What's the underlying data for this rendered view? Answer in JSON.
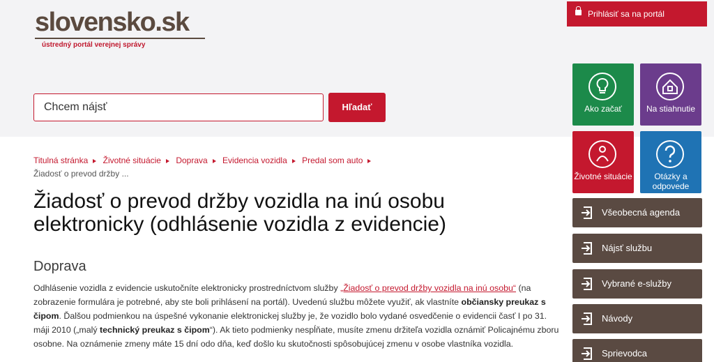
{
  "logo": {
    "name": "slovensko.sk",
    "tagline": "ústredný portál verejnej správy"
  },
  "header": {
    "login_label": "Prihlásiť sa na portál"
  },
  "search": {
    "placeholder": "Chcem nájsť",
    "button_label": "Hľadať"
  },
  "tiles": [
    {
      "label": "Ako začať",
      "icon": "lightbulb-icon",
      "color": "#1c8a4a"
    },
    {
      "label": "Na stiahnutie",
      "icon": "download-house-icon",
      "color": "#6b3c8c"
    },
    {
      "label": "Životné situácie",
      "icon": "person-icon",
      "color": "#c4182e"
    },
    {
      "label": "Otázky a odpovede",
      "icon": "question-icon",
      "color": "#1f73b4"
    }
  ],
  "side_menu": [
    {
      "label": "Všeobecná agenda"
    },
    {
      "label": "Nájsť službu"
    },
    {
      "label": "Vybrané e-služby"
    },
    {
      "label": "Návody"
    },
    {
      "label": "Sprievodca"
    }
  ],
  "breadcrumb": {
    "items": [
      "Titulná stránka",
      "Životné situácie",
      "Doprava",
      "Evidencia vozidla",
      "Predal som auto"
    ],
    "current": "Žiadosť o prevod držby ..."
  },
  "page": {
    "title_line1": "Žiadosť o prevod držby vozidla na inú osobu",
    "title_line2": "elektronicky (odhlásenie vozidla z evidencie)",
    "section": "Doprava",
    "p_part1": "Odhlásenie vozidla z evidencie uskutočníte elektronicky prostredníctvom služby ",
    "p_link": "„Žiadosť o prevod držby vozidla na inú osobu“",
    "p_part2": " (na zobrazenie formulára je potrebné, aby ste boli prihlásení na portál). Uvedenú službu môžete využiť, ak vlastníte ",
    "p_bold1": "občiansky preukaz s čipom",
    "p_part3": ". Ďalšou podmienkou na úspešné vykonanie elektronickej služby je, že vozidlo bolo vydané osvedčenie o evidencii časť I po 31. máji 2010 („malý ",
    "p_bold2": "technický preukaz s čipom",
    "p_part4": "“). Ak tieto podmienky nespĺňate, musíte zmenu držiteľa vozidla oznámiť Policajnému zboru osobne. Na oznámenie zmeny máte 15 dní odo dňa, keď došlo ku skutočnosti spôsobujúcej zmenu v osobe vlastníka vozidla."
  }
}
